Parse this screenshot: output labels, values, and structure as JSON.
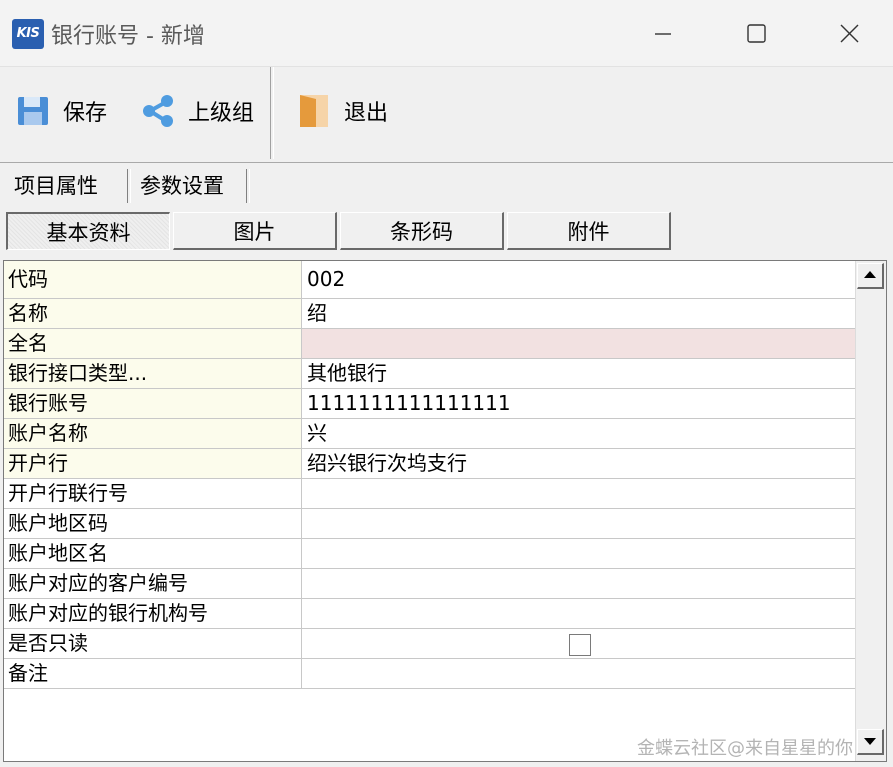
{
  "window": {
    "app_logo": "KIS",
    "title": "银行账号 - 新增",
    "minimize_icon": "minimize-icon",
    "maximize_icon": "maximize-icon",
    "close_icon": "close-icon"
  },
  "toolbar": {
    "save": {
      "label": "保存",
      "icon": "floppy-disk-icon"
    },
    "parent_group": {
      "label": "上级组",
      "icon": "share-nodes-icon"
    },
    "exit": {
      "label": "退出",
      "icon": "exit-door-icon"
    }
  },
  "tabs": [
    {
      "label": "项目属性",
      "active": true
    },
    {
      "label": "参数设置",
      "active": false
    }
  ],
  "subtabs": [
    {
      "label": "基本资料",
      "active": true
    },
    {
      "label": "图片",
      "active": false
    },
    {
      "label": "条形码",
      "active": false
    },
    {
      "label": "附件",
      "active": false
    }
  ],
  "fields": [
    {
      "label": "代码",
      "value": "002",
      "required": true
    },
    {
      "label": "名称",
      "value": "绍",
      "required": true
    },
    {
      "label": "全名",
      "value": "",
      "required": true,
      "highlight": "#f2e1e1"
    },
    {
      "label": "银行接口类型...",
      "value": "其他银行",
      "required": true
    },
    {
      "label": "银行账号",
      "value": "1111111111111111",
      "required": true
    },
    {
      "label": "账户名称",
      "value": "兴",
      "required": true
    },
    {
      "label": "开户行",
      "value": "绍兴银行次坞支行",
      "required": true
    },
    {
      "label": "开户行联行号",
      "value": "",
      "required": false
    },
    {
      "label": "账户地区码",
      "value": "",
      "required": false
    },
    {
      "label": "账户地区名",
      "value": "",
      "required": false
    },
    {
      "label": "账户对应的客户编号",
      "value": "",
      "required": false
    },
    {
      "label": "账户对应的银行机构号",
      "value": "",
      "required": false
    },
    {
      "label": "是否只读",
      "value": "",
      "required": false,
      "checkbox": false
    },
    {
      "label": "备注",
      "value": "",
      "required": false
    }
  ],
  "watermark": "金蝶云社区@来自星星的你",
  "colors": {
    "required_label_bg": "#fcfcec",
    "highlight_value_bg": "#f2e1e1",
    "logo_bg": "#2a5fb0",
    "save_icon": "#4a8ed6",
    "share_icon": "#4f9ce0",
    "exit_icon": "#e59a3c"
  }
}
